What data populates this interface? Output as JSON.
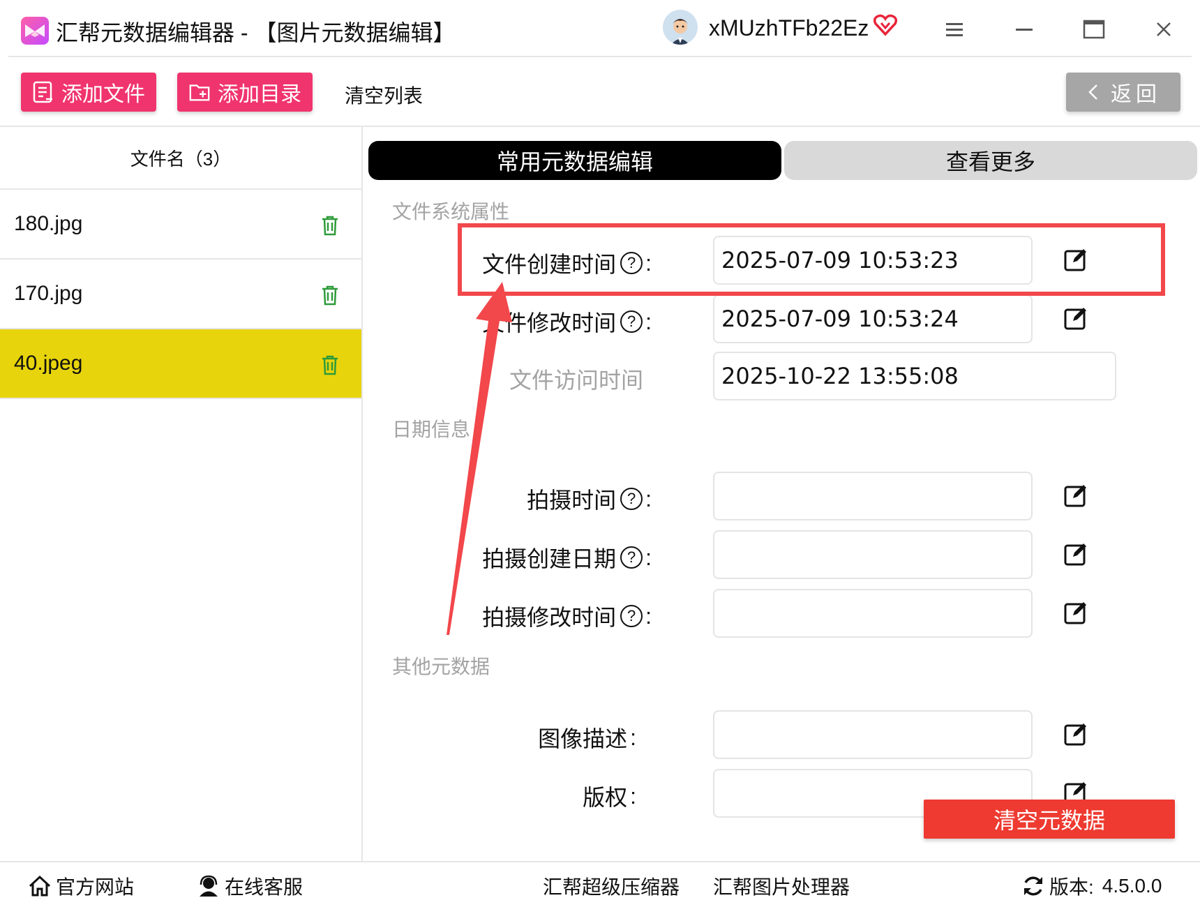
{
  "window": {
    "app_name": "汇帮元数据编辑器",
    "title_separator": "-",
    "module_title": "【图片元数据编辑】",
    "username": "xMUzhTFb22Ez",
    "icons": [
      "app-logo-icon",
      "avatar",
      "vip-heart-icon",
      "menu-icon",
      "minimize-icon",
      "maximize-icon",
      "close-icon"
    ]
  },
  "toolbar": {
    "add_file_label": "添加文件",
    "add_folder_label": "添加目录",
    "clear_list_label": "清空列表",
    "back_label": "返回",
    "accent_color": "#f0346e"
  },
  "sidebar": {
    "header": "文件名（3）",
    "files": [
      {
        "name": "180.jpg",
        "selected": false
      },
      {
        "name": "170.jpg",
        "selected": false
      },
      {
        "name": "40.jpeg",
        "selected": true
      }
    ],
    "selected_color": "#e8d40c"
  },
  "tabs": {
    "active": "常用元数据编辑",
    "more": "查看更多"
  },
  "sections": {
    "fs": {
      "title": "文件系统属性",
      "created_label": "文件创建时间",
      "created_value": "2025-07-09 10:53:23",
      "modified_label": "文件修改时间",
      "modified_value": "2025-07-09 10:53:24",
      "accessed_label": "文件访问时间",
      "accessed_value": "2025-10-22 13:55:08"
    },
    "date": {
      "title": "日期信息",
      "shot_time_label": "拍摄时间",
      "shot_time_value": "",
      "shot_created_label": "拍摄创建日期",
      "shot_created_value": "",
      "shot_modified_label": "拍摄修改时间",
      "shot_modified_value": ""
    },
    "other": {
      "title": "其他元数据",
      "description_label": "图像描述",
      "description_value": "",
      "copyright_label": "版权",
      "copyright_value": ""
    }
  },
  "clear_metadata_label": "清空元数据",
  "status": {
    "website": "官方网站",
    "support": "在线客服",
    "compressor": "汇帮超级压缩器",
    "image_processor": "汇帮图片处理器",
    "version_label": "版本:",
    "version_value": "4.5.0.0"
  },
  "colors": {
    "highlight_red": "#f2474b",
    "clear_button_red": "#ee3a30",
    "back_gray": "#a6a6a6"
  }
}
